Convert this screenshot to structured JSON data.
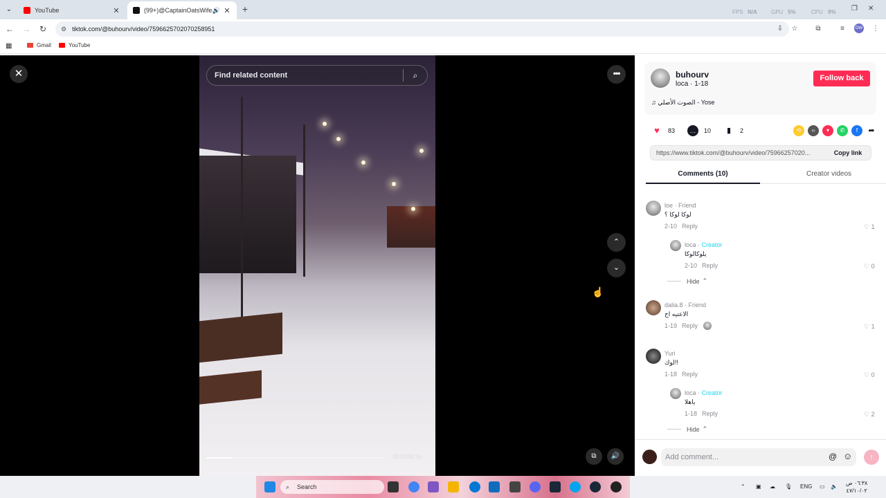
{
  "browser": {
    "tabs": [
      {
        "title": "YouTube",
        "icon": "youtube-icon"
      },
      {
        "title": "(99+)@CaptainOatsWife (@",
        "icon": "tiktok-icon"
      }
    ],
    "perf": {
      "fps_label": "FPS",
      "fps_value": "N/A",
      "gpu_label": "GPU",
      "gpu_value": "5%",
      "cpu_label": "CPU",
      "cpu_value": "9%"
    },
    "url": "tiktok.com/@buhourv/video/7596625702070258951",
    "bookmarks": [
      {
        "label": "Gmail",
        "icon": "gmail-icon",
        "color": "#ea4335"
      },
      {
        "label": "YouTube",
        "icon": "youtube-icon",
        "color": "#ff0000"
      }
    ],
    "profile_initials": "OW"
  },
  "video": {
    "search_placeholder": "Find related content",
    "timecode": "00:02/00:16",
    "progress": 0.15
  },
  "author": {
    "username": "buhourv",
    "subtitle": "loca · 1-18",
    "follow_label": "Follow back",
    "music": "الصوت الأصلي - Yose"
  },
  "stats": {
    "likes": "83",
    "comments": "10",
    "saves": "2"
  },
  "share": {
    "url": "https://www.tiktok.com/@buhourv/video/75966257020...",
    "copy_label": "Copy link"
  },
  "panel_tabs": {
    "comments": "Comments (10)",
    "creator": "Creator videos"
  },
  "comments": [
    {
      "user": "loe",
      "tag": "Friend",
      "text": "لوكا لوكا ؟",
      "date": "2-10",
      "reply": "Reply",
      "likes": "1"
    },
    {
      "user": "loca",
      "tag": "Creator",
      "text": "يلوكالوكا",
      "date": "2-10",
      "reply": "Reply",
      "likes": "0"
    },
    {
      "user": "dalia.8",
      "tag": "Friend",
      "text": "الاعتيه اح",
      "date": "1-19",
      "reply": "Reply",
      "likes": "1"
    },
    {
      "user": "Yuri",
      "tag": "",
      "text": "لوك!!",
      "date": "1-18",
      "reply": "Reply",
      "likes": "0"
    },
    {
      "user": "loca",
      "tag": "Creator",
      "text": "ياهلا",
      "date": "1-18",
      "reply": "Reply",
      "likes": "2"
    }
  ],
  "hide_label": "Hide",
  "add_comment_placeholder": "Add comment...",
  "taskbar": {
    "search_label": "Search",
    "lang": "ENG",
    "time": "٠٦:٣٨ ص",
    "date": "٤٧/١٠/٠٢"
  }
}
